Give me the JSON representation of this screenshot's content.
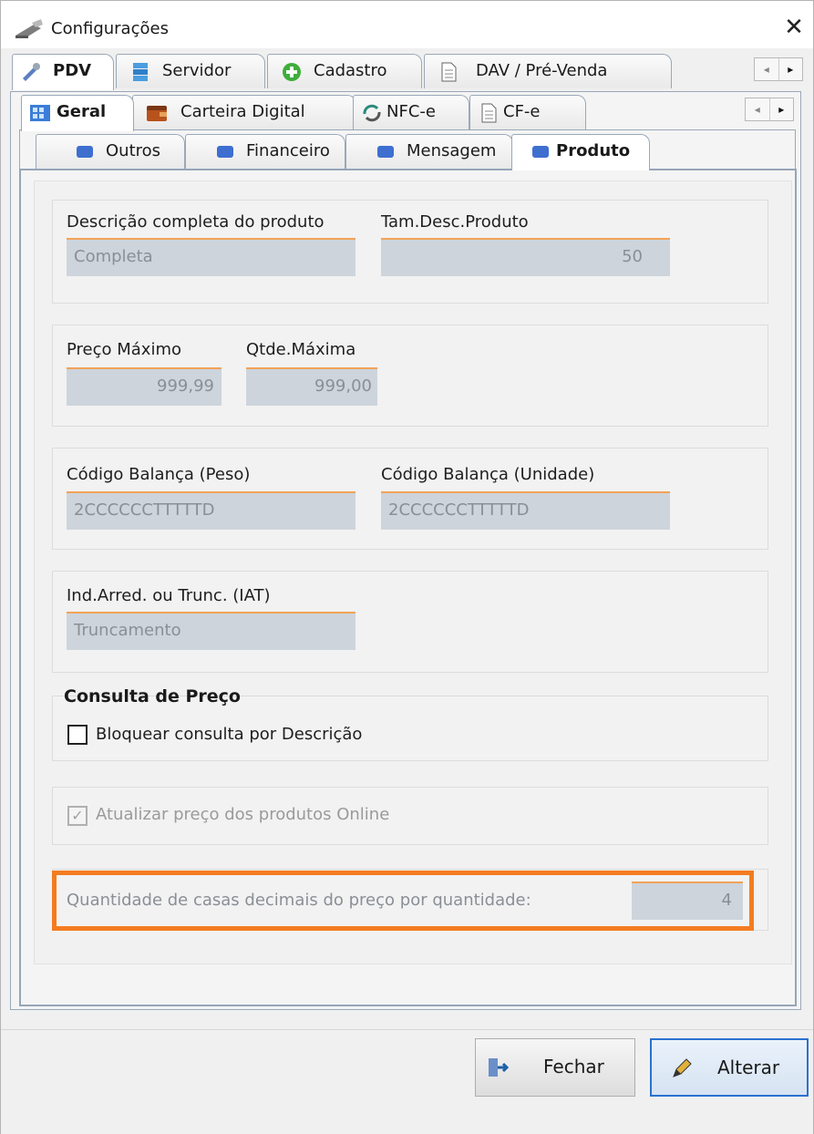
{
  "window": {
    "title": "Configurações",
    "close_glyph": "✕"
  },
  "tabs_level1": [
    {
      "label": "PDV",
      "icon": "tools-icon",
      "active": true
    },
    {
      "label": "Servidor",
      "icon": "server-icon"
    },
    {
      "label": "Cadastro",
      "icon": "add-circle-icon"
    },
    {
      "label": "DAV / Pré-Venda",
      "icon": "document-icon"
    }
  ],
  "tabs_level2": [
    {
      "label": "Geral",
      "icon": "grid-icon",
      "active": true
    },
    {
      "label": "Carteira Digital",
      "icon": "wallet-icon"
    },
    {
      "label": "NFC-e",
      "icon": "sync-icon"
    },
    {
      "label": "CF-e",
      "icon": "document-icon"
    }
  ],
  "tabs_level3": [
    {
      "label": "Outros"
    },
    {
      "label": "Financeiro"
    },
    {
      "label": "Mensagem"
    },
    {
      "label": "Produto",
      "active": true
    }
  ],
  "scroll": {
    "left": "◂",
    "right": "▸"
  },
  "fields": {
    "descricao_label": "Descrição completa do produto",
    "descricao_value": "Completa",
    "tamdesc_label": "Tam.Desc.Produto",
    "tamdesc_value": "50",
    "preco_max_label": "Preço Máximo",
    "preco_max_value": "999,99",
    "qtde_max_label": "Qtde.Máxima",
    "qtde_max_value": "999,00",
    "cod_peso_label": "Código Balança (Peso)",
    "cod_peso_value": "2CCCCCCTTTTTD",
    "cod_unid_label": "Código Balança (Unidade)",
    "cod_unid_value": "2CCCCCCTTTTTD",
    "iat_label": "Ind.Arred. ou Trunc. (IAT)",
    "iat_value": "Truncamento"
  },
  "consulta": {
    "title": "Consulta de Preço",
    "bloquear_label": "Bloquear consulta por Descrição",
    "bloquear_checked": false
  },
  "online": {
    "label": "Atualizar preço dos produtos Online",
    "checked": true,
    "check_glyph": "✓"
  },
  "decimais": {
    "label": "Quantidade de casas decimais do preço por quantidade:",
    "value": "4"
  },
  "buttons": {
    "fechar": "Fechar",
    "alterar": "Alterar"
  },
  "colors": {
    "accent": "#f47c20",
    "field_bg": "#cdd4dc",
    "primary_border": "#2a72d0"
  }
}
